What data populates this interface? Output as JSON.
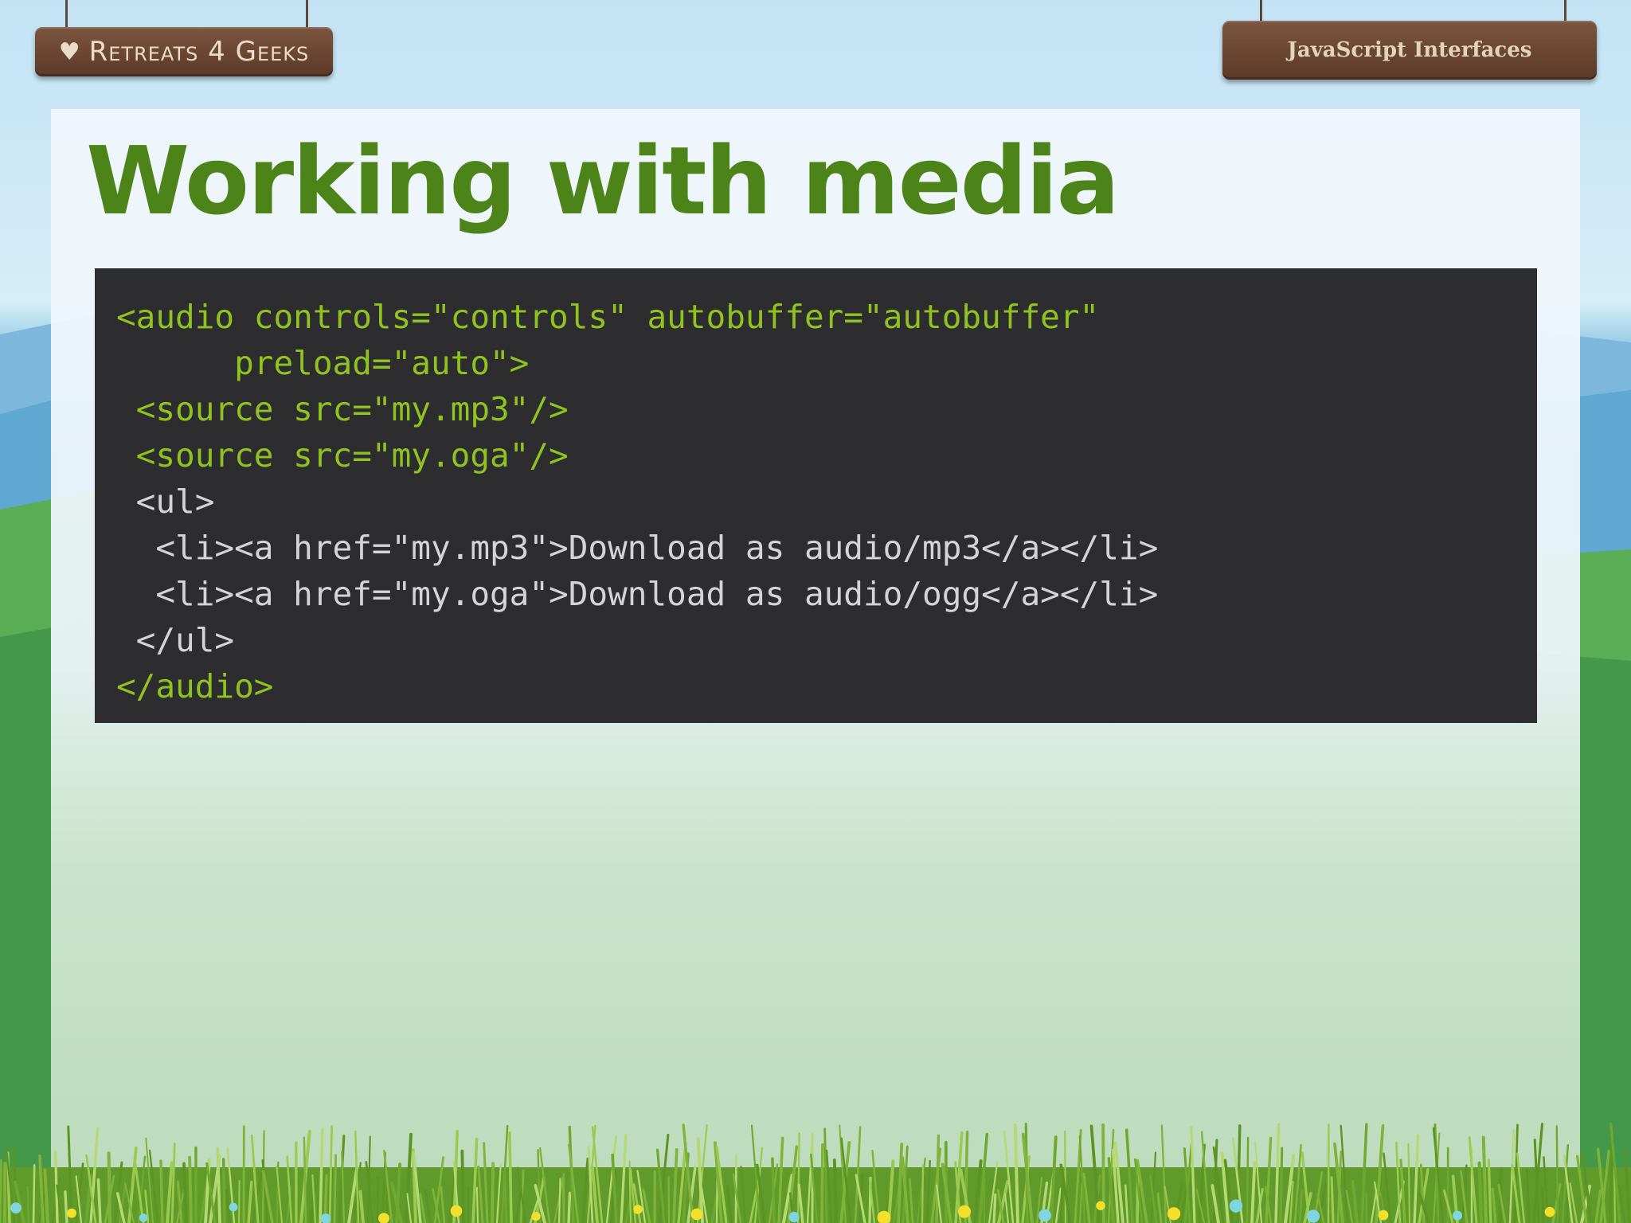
{
  "colors": {
    "title_green": "#4d8419",
    "code_background": "#2d2c2f",
    "code_highlight": "#8fc31f",
    "code_plain": "#d4d4d4",
    "sign_wood": "#6a4632",
    "panel": "#eef6fc"
  },
  "header": {
    "brand_icon": "heart-icon",
    "brand_label": "Retreats 4 Geeks",
    "deck_title": "JavaScript Interfaces"
  },
  "slide": {
    "title": "Working with media",
    "code_lines": [
      {
        "text": "<audio controls=\"controls\" autobuffer=\"autobuffer\"",
        "highlight": true
      },
      {
        "text": "      preload=\"auto\">",
        "highlight": true
      },
      {
        "text": " <source src=\"my.mp3\"/>",
        "highlight": true
      },
      {
        "text": " <source src=\"my.oga\"/>",
        "highlight": true
      },
      {
        "text": " <ul>",
        "highlight": false
      },
      {
        "text": "  <li><a href=\"my.mp3\">Download as audio/mp3</a></li>",
        "highlight": false
      },
      {
        "text": "  <li><a href=\"my.oga\">Download as audio/ogg</a></li>",
        "highlight": false
      },
      {
        "text": " </ul>",
        "highlight": false
      },
      {
        "text": "</audio>",
        "highlight": true
      }
    ]
  }
}
